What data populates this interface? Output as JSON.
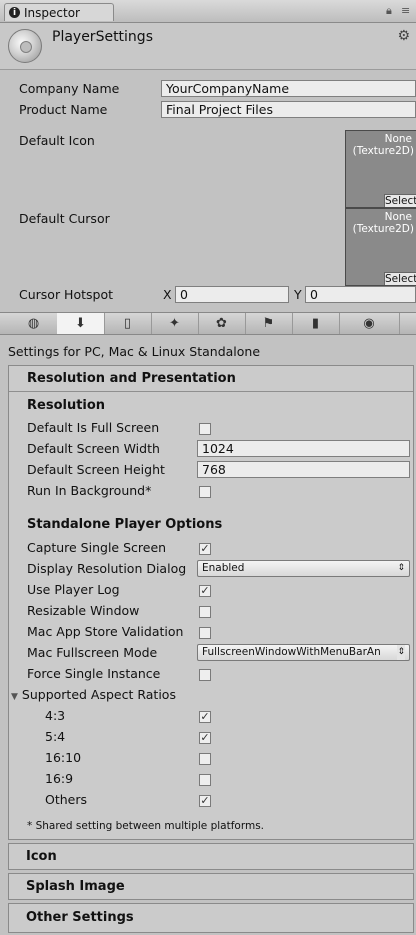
{
  "window": {
    "tab_title": "Inspector",
    "tab_icon": "info-icon",
    "lock_icon": "lock-icon",
    "menu_icon": "tab-menu-icon"
  },
  "header": {
    "title": "PlayerSettings",
    "settings_icon": "settings-gear-icon"
  },
  "fields": {
    "company_name": {
      "label": "Company Name",
      "value": "YourCompanyName"
    },
    "product_name": {
      "label": "Product Name",
      "value": "Final Project Files"
    },
    "default_icon": {
      "label": "Default Icon",
      "tex_none": "None",
      "tex_type": "(Texture2D)",
      "select": "Select"
    },
    "default_cursor": {
      "label": "Default Cursor",
      "tex_none": "None",
      "tex_type": "(Texture2D)",
      "select": "Select"
    },
    "cursor_hotspot": {
      "label": "Cursor Hotspot",
      "x_label": "X",
      "x_value": "0",
      "y_label": "Y",
      "y_value": "0"
    }
  },
  "platform_tabs": [
    {
      "name": "web-player-icon",
      "glyph": "◍",
      "active": false
    },
    {
      "name": "standalone-download-icon",
      "glyph": "⬇",
      "active": true
    },
    {
      "name": "ios-icon",
      "glyph": "▯",
      "active": false
    },
    {
      "name": "android-icon",
      "glyph": "✦",
      "active": false
    },
    {
      "name": "blackberry-icon",
      "glyph": "✿",
      "active": false
    },
    {
      "name": "windows-store-icon",
      "glyph": "⚑",
      "active": false
    },
    {
      "name": "windows-phone-icon",
      "glyph": "▮",
      "active": false
    },
    {
      "name": "console-icon",
      "glyph": "◉",
      "active": false
    }
  ],
  "settings_for": "Settings for PC, Mac & Linux Standalone",
  "resolution_section": {
    "title": "Resolution and Presentation",
    "resolution_heading": "Resolution",
    "default_full_screen": {
      "label": "Default Is Full Screen",
      "checked": false
    },
    "default_width": {
      "label": "Default Screen Width",
      "value": "1024"
    },
    "default_height": {
      "label": "Default Screen Height",
      "value": "768"
    },
    "run_in_background": {
      "label": "Run In Background*",
      "checked": false
    },
    "standalone_heading": "Standalone Player Options",
    "capture_single_screen": {
      "label": "Capture Single Screen",
      "checked": true
    },
    "display_resolution_dialog": {
      "label": "Display Resolution Dialog",
      "value": "Enabled"
    },
    "use_player_log": {
      "label": "Use Player Log",
      "checked": true
    },
    "resizable_window": {
      "label": "Resizable Window",
      "checked": false
    },
    "mac_app_store_validation": {
      "label": "Mac App Store Validation",
      "checked": false
    },
    "mac_fullscreen_mode": {
      "label": "Mac Fullscreen Mode",
      "value": "FullscreenWindowWithMenuBarAn"
    },
    "force_single_instance": {
      "label": "Force Single Instance",
      "checked": false
    },
    "supported_aspect_ratios": {
      "label": "Supported Aspect Ratios",
      "expanded": true
    },
    "ratio_4_3": {
      "label": "4:3",
      "checked": true
    },
    "ratio_5_4": {
      "label": "5:4",
      "checked": true
    },
    "ratio_16_10": {
      "label": "16:10",
      "checked": false
    },
    "ratio_16_9": {
      "label": "16:9",
      "checked": false
    },
    "ratio_others": {
      "label": "Others",
      "checked": true
    },
    "footnote": "* Shared setting between multiple platforms."
  },
  "collapsed_sections": {
    "icon": "Icon",
    "splash_image": "Splash Image",
    "other_settings": "Other Settings"
  },
  "check_glyph": "✓"
}
